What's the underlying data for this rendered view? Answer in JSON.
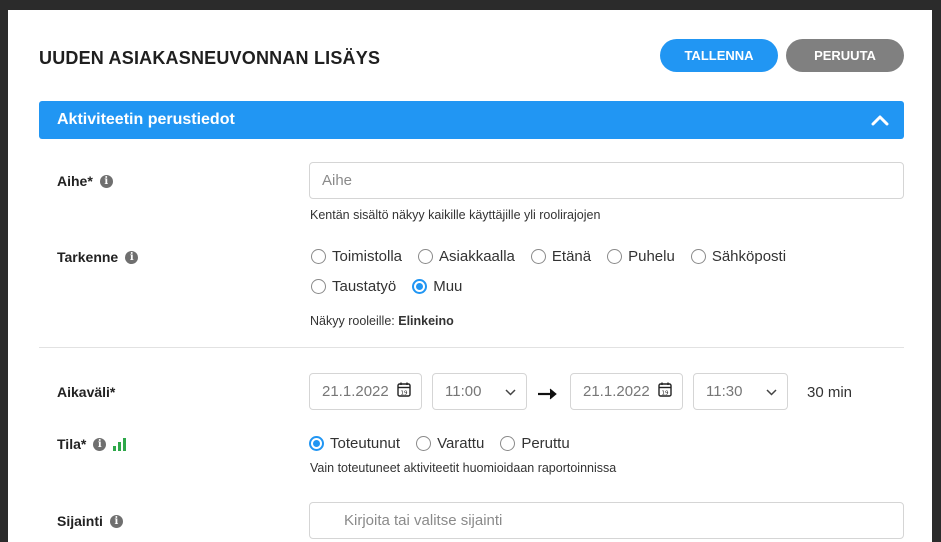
{
  "page": {
    "title": "UUDEN ASIAKASNEUVONNAN LISÄYS",
    "save_label": "TALLENNA",
    "cancel_label": "PERUUTA"
  },
  "section": {
    "title": "Aktiviteetin perustiedot"
  },
  "aihe": {
    "label": "Aihe*",
    "placeholder": "Aihe",
    "helper": "Kentän sisältö näkyy kaikille käyttäjille yli roolirajojen"
  },
  "tarkenne": {
    "label": "Tarkenne",
    "options": [
      "Toimistolla",
      "Asiakkaalla",
      "Etänä",
      "Puhelu",
      "Sähköposti",
      "Taustatyö",
      "Muu"
    ],
    "selected": "Muu",
    "visibility_prefix": "Näkyy rooleille: ",
    "visibility_role": "Elinkeino"
  },
  "aikavali": {
    "label": "Aikaväli*",
    "start_date": "21.1.2022",
    "start_time": "11:00",
    "end_date": "21.1.2022",
    "end_time": "11:30",
    "duration": "30 min"
  },
  "tila": {
    "label": "Tila*",
    "options": [
      "Toteutunut",
      "Varattu",
      "Peruttu"
    ],
    "selected": "Toteutunut",
    "helper": "Vain toteutuneet aktiviteetit huomioidaan raportoinnissa"
  },
  "sijainti": {
    "label": "Sijainti",
    "placeholder": "Kirjoita tai valitse sijainti"
  },
  "colors": {
    "accent": "#2196f3",
    "cancel": "#808080",
    "signal": "#2ea84a"
  },
  "icons": {
    "info": "info-icon",
    "calendar": "calendar-icon",
    "chevron": "chevron-down-icon",
    "collapse": "chevron-up-icon",
    "location": "location-pin-icon",
    "arrow": "arrow-right-icon",
    "signal": "signal-bars-icon"
  }
}
